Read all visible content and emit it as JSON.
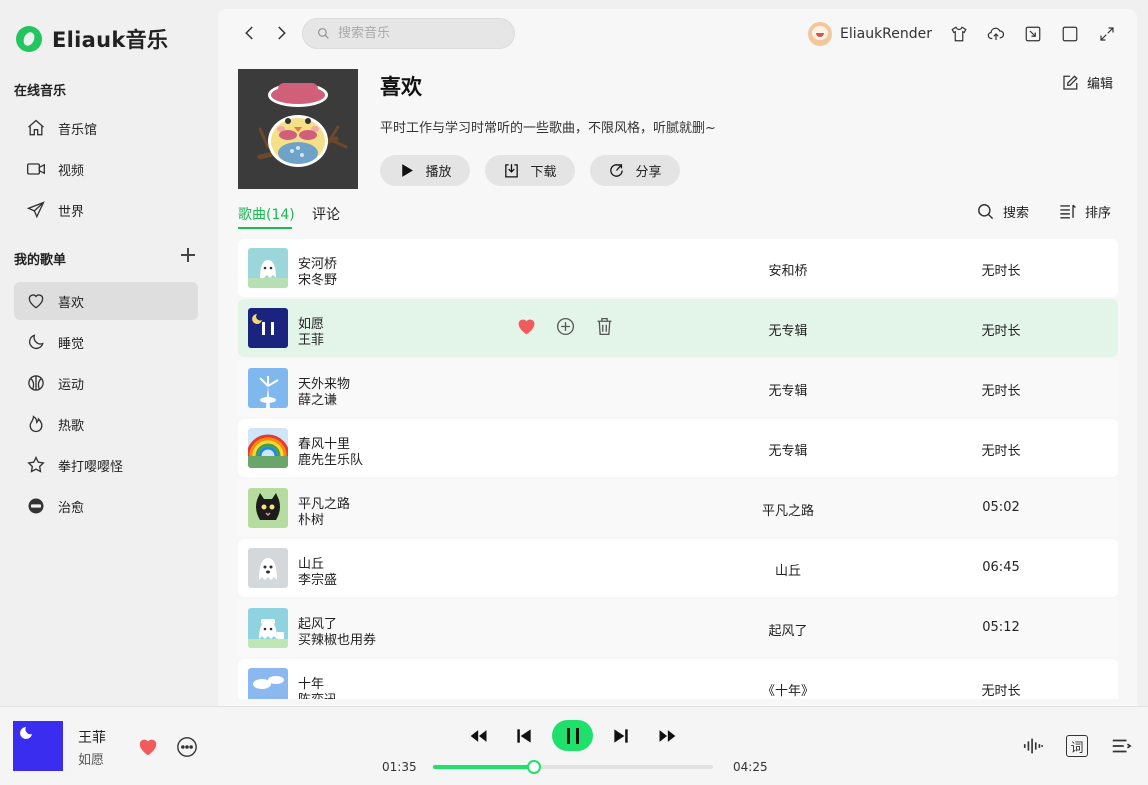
{
  "app": {
    "name": "Eliauk音乐"
  },
  "sidebar": {
    "online_title": "在线音乐",
    "online_items": [
      {
        "label": "音乐馆",
        "icon": "home-icon"
      },
      {
        "label": "视频",
        "icon": "video-icon"
      },
      {
        "label": "世界",
        "icon": "send-icon"
      }
    ],
    "my_title": "我的歌单",
    "my_items": [
      {
        "label": "喜欢",
        "icon": "heart-icon",
        "active": true
      },
      {
        "label": "睡觉",
        "icon": "moon-icon"
      },
      {
        "label": "运动",
        "icon": "basketball-icon"
      },
      {
        "label": "热歌",
        "icon": "flame-icon"
      },
      {
        "label": "拳打嘤嘤怪",
        "icon": "star-icon"
      },
      {
        "label": "治愈",
        "icon": "emoji-icon"
      }
    ]
  },
  "topbar": {
    "search_placeholder": "搜索音乐",
    "username": "EliaukRender"
  },
  "playlist": {
    "title": "喜欢",
    "description": "平时工作与学习时常听的一些歌曲，不限风格，听腻就删~",
    "edit_label": "编辑",
    "play_label": "播放",
    "download_label": "下载",
    "share_label": "分享"
  },
  "tabs": {
    "songs_label": "歌曲(14)",
    "comments_label": "评论",
    "search_label": "搜索",
    "sort_label": "排序"
  },
  "songs": [
    {
      "title": "安河桥",
      "artist": "宋冬野",
      "album": "安和桥",
      "duration": "无时长",
      "thumb": "ghost-teal"
    },
    {
      "title": "如愿",
      "artist": "王菲",
      "album": "无专辑",
      "duration": "无时长",
      "thumb": "playing",
      "active": true
    },
    {
      "title": "天外来物",
      "artist": "薛之谦",
      "album": "无专辑",
      "duration": "无时长",
      "thumb": "sky-blue"
    },
    {
      "title": "春风十里",
      "artist": "鹿先生乐队",
      "album": "无专辑",
      "duration": "无时长",
      "thumb": "rainbow"
    },
    {
      "title": "平凡之路",
      "artist": "朴树",
      "album": "平凡之路",
      "duration": "05:02",
      "thumb": "black-cat"
    },
    {
      "title": "山丘",
      "artist": "李宗盛",
      "album": "山丘",
      "duration": "06:45",
      "thumb": "ghost-grey"
    },
    {
      "title": "起风了",
      "artist": "买辣椒也用券",
      "album": "起风了",
      "duration": "05:12",
      "thumb": "ghost-teal2"
    },
    {
      "title": "十年",
      "artist": "陈奕迅",
      "album": "《十年》",
      "duration": "无时长",
      "thumb": "cloud-blue"
    }
  ],
  "player": {
    "artist": "王菲",
    "title": "如愿",
    "current_time": "01:35",
    "total_time": "04:25",
    "progress": 0.36,
    "lyrics_label": "词"
  },
  "colors": {
    "accent": "#1ee06a",
    "tab_accent": "#1db954",
    "heart": "#f25b5b",
    "active_row": "#e3f5e9"
  }
}
